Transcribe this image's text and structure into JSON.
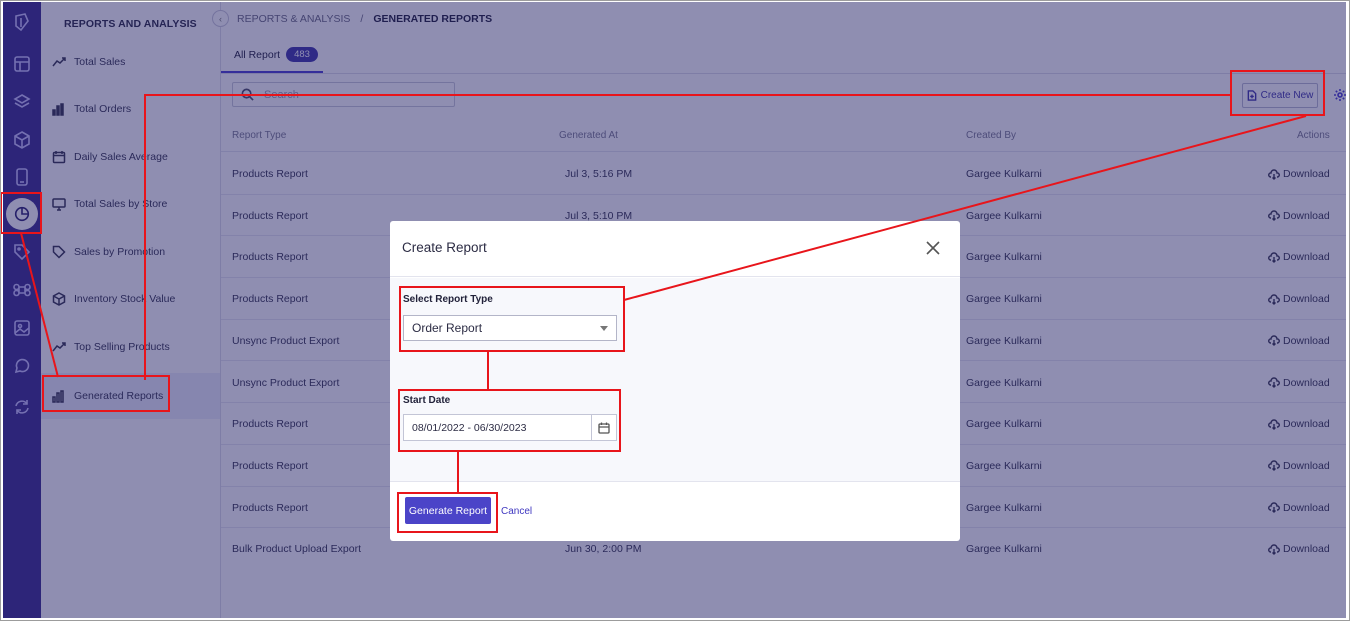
{
  "sidebar": {
    "heading": "REPORTS AND ANALYSIS",
    "items": [
      {
        "label": "Total Sales",
        "icon": "trend-up-icon"
      },
      {
        "label": "Total Orders",
        "icon": "bar-chart-icon"
      },
      {
        "label": "Daily Sales Average",
        "icon": "calendar-icon"
      },
      {
        "label": "Total Sales by Store",
        "icon": "monitor-icon"
      },
      {
        "label": "Sales by Promotion",
        "icon": "tag-icon"
      },
      {
        "label": "Inventory Stock Value",
        "icon": "box-icon"
      },
      {
        "label": "Top Selling Products",
        "icon": "trend-up-icon"
      },
      {
        "label": "Generated Reports",
        "icon": "bar-chart-icon"
      }
    ]
  },
  "breadcrumb": {
    "parent": "REPORTS & ANALYSIS",
    "separator": "/",
    "current": "GENERATED REPORTS"
  },
  "tabs": [
    {
      "label": "All Report",
      "count": "483"
    }
  ],
  "search": {
    "placeholder": "Search"
  },
  "toolbar": {
    "create_label": "Create New"
  },
  "table": {
    "columns": [
      "Report Type",
      "Generated At",
      "Created By",
      "Actions"
    ],
    "download_label": "Download",
    "rows": [
      {
        "type": "Products Report",
        "generated": "Jul 3, 5:16 PM",
        "by": "Gargee Kulkarni"
      },
      {
        "type": "Products Report",
        "generated": "Jul 3, 5:10 PM",
        "by": "Gargee Kulkarni"
      },
      {
        "type": "Products Report",
        "generated": "",
        "by": "Gargee Kulkarni"
      },
      {
        "type": "Products Report",
        "generated": "",
        "by": "Gargee Kulkarni"
      },
      {
        "type": "Unsync Product Export",
        "generated": "",
        "by": "Gargee Kulkarni"
      },
      {
        "type": "Unsync Product Export",
        "generated": "",
        "by": "Gargee Kulkarni"
      },
      {
        "type": "Products Report",
        "generated": "",
        "by": "Gargee Kulkarni"
      },
      {
        "type": "Products Report",
        "generated": "",
        "by": "Gargee Kulkarni"
      },
      {
        "type": "Products Report",
        "generated": "",
        "by": "Gargee Kulkarni"
      },
      {
        "type": "Bulk Product Upload Export",
        "generated": "Jun 30, 2:00 PM",
        "by": "Gargee Kulkarni"
      }
    ]
  },
  "modal": {
    "title": "Create Report",
    "report_type_label": "Select Report Type",
    "report_type_value": "Order Report",
    "start_date_label": "Start Date",
    "start_date_value": "08/01/2022 - 06/30/2023",
    "generate_label": "Generate Report",
    "cancel_label": "Cancel"
  },
  "colors": {
    "accent": "#4b44c8",
    "rail": "#3a2d8f",
    "annotation": "#e8151b"
  }
}
